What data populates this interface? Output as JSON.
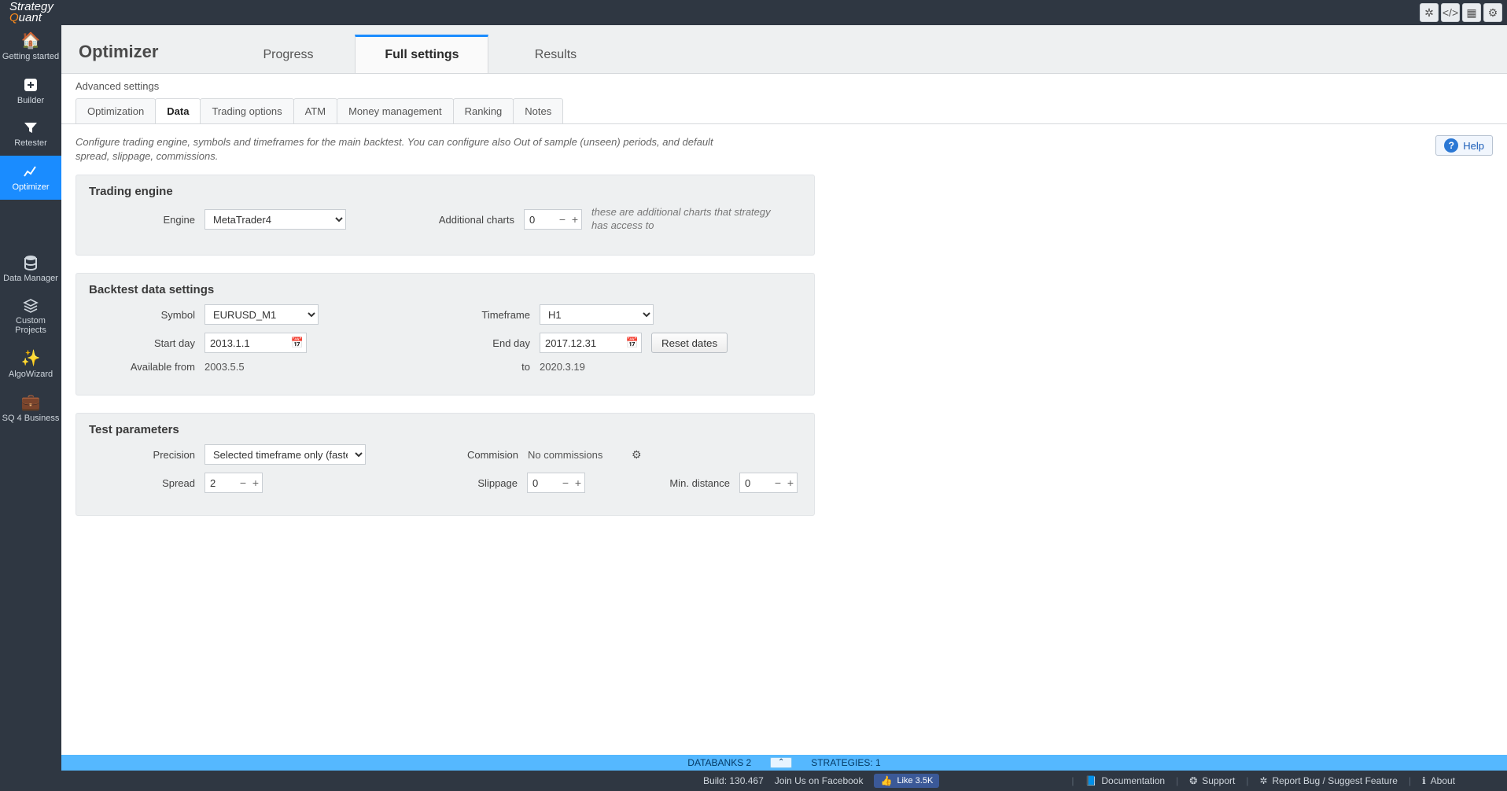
{
  "app": {
    "logo_top": "Strategy",
    "logo_bottom": "Quant"
  },
  "titlebar_buttons": [
    "bug",
    "code",
    "grid",
    "gear"
  ],
  "sidebar": {
    "items": [
      {
        "label": "Getting started"
      },
      {
        "label": "Builder"
      },
      {
        "label": "Retester"
      },
      {
        "label": "Optimizer"
      },
      {
        "label": "Data Manager"
      },
      {
        "label": "Custom Projects"
      },
      {
        "label": "AlgoWizard"
      },
      {
        "label": "SQ 4 Business"
      }
    ],
    "active_index": 3
  },
  "page": {
    "title": "Optimizer",
    "big_tabs": [
      "Progress",
      "Full settings",
      "Results"
    ],
    "big_active": 1,
    "sub_header": "Advanced settings",
    "tabs": [
      "Optimization",
      "Data",
      "Trading options",
      "ATM",
      "Money management",
      "Ranking",
      "Notes"
    ],
    "tab_active": 1,
    "info": "Configure trading engine, symbols and timeframes for the main backtest. You can configure also Out of sample (unseen) periods, and default spread, slippage, commissions.",
    "help_label": "Help"
  },
  "trading_engine": {
    "title": "Trading engine",
    "engine_label": "Engine",
    "engine_value": "MetaTrader4",
    "addcharts_label": "Additional charts",
    "addcharts_value": "0",
    "addcharts_hint": "these are additional charts that strategy has access to"
  },
  "backtest": {
    "title": "Backtest data settings",
    "symbol_label": "Symbol",
    "symbol_value": "EURUSD_M1",
    "timeframe_label": "Timeframe",
    "timeframe_value": "H1",
    "start_label": "Start day",
    "start_value": "2013.1.1",
    "end_label": "End day",
    "end_value": "2017.12.31",
    "reset_label": "Reset dates",
    "avail_from_label": "Available from",
    "avail_from_value": "2003.5.5",
    "avail_to_label": "to",
    "avail_to_value": "2020.3.19"
  },
  "test": {
    "title": "Test parameters",
    "precision_label": "Precision",
    "precision_value": "Selected timeframe only (faste...",
    "commission_label": "Commision",
    "commission_value": "No commissions",
    "spread_label": "Spread",
    "spread_value": "2",
    "slippage_label": "Slippage",
    "slippage_value": "0",
    "mindist_label": "Min. distance",
    "mindist_value": "0"
  },
  "bottom": {
    "databanks_label": "DATABANKS 2",
    "strategies_label": "STRATEGIES: 1"
  },
  "footer": {
    "build": "Build: 130.467",
    "join": "Join Us on Facebook",
    "like": "Like 3.5K",
    "docs": "Documentation",
    "support": "Support",
    "report": "Report Bug / Suggest Feature",
    "about": "About"
  }
}
